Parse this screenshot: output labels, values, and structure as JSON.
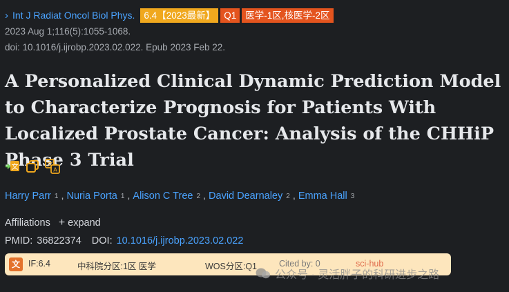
{
  "journal": {
    "chevron_icon": "chevron-right-icon",
    "name": "Int J Radiat Oncol Biol Phys.",
    "if_badge": "6.4【2023最新】",
    "quartile_badge": "Q1",
    "zone_badge": "医学-1区,核医学-2区",
    "colors": {
      "link": "#4aa3ff",
      "if": "#f0a81e",
      "quartile": "#e4541e"
    }
  },
  "citation": {
    "date_line": "2023 Aug 1;116(5):1055-1068.",
    "doi_line": "doi: 10.1016/j.ijrobp.2023.02.022. Epub 2023 Feb 22."
  },
  "title": "A Personalized Clinical Dynamic Prediction Model to Characterize Prognosis for Patients With Localized Prostate Cancer: Analysis of the CHHiP Phase 3 Trial",
  "tools": [
    "translate-icon",
    "copy-icon",
    "translate-text-icon"
  ],
  "authors": [
    {
      "name": "Harry Parr",
      "aff": "1"
    },
    {
      "name": "Nuria Porta",
      "aff": "1"
    },
    {
      "name": "Alison C Tree",
      "aff": "2"
    },
    {
      "name": "David Dearnaley",
      "aff": "2"
    },
    {
      "name": "Emma Hall",
      "aff": "3"
    }
  ],
  "affiliations": {
    "label": "Affiliations",
    "expand_label": "expand"
  },
  "ids": {
    "pmid_label": "PMID:",
    "pmid": "36822374",
    "doi_label": "DOI:",
    "doi": "10.1016/j.ijrobp.2023.02.022"
  },
  "infobar": {
    "logo": "文",
    "if": "IF:6.4",
    "cas": "中科院分区:1区 医学",
    "wos": "WOS分区:Q1",
    "cited": "Cited by: 0",
    "hub": "sci-hub"
  },
  "watermark": "公众号 · 灵活胖子的科研进步之路"
}
